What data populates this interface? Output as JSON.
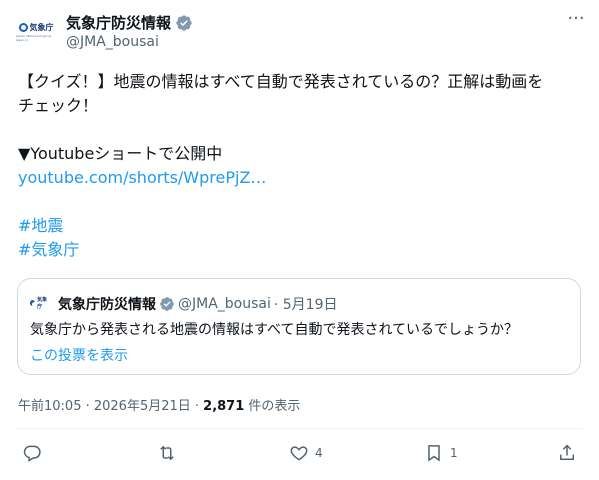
{
  "author": {
    "name": "気象庁防災情報",
    "handle": "@JMA_bousai",
    "logo_text": "気象庁",
    "logo_sub": "Japan Meteorological Agency"
  },
  "post": {
    "lines": [
      "【クイズ！】地震の情報はすべて自動で発表されているの？正解は動画を",
      "チェック！",
      "",
      "▼Youtubeショートで公開中",
      "youtube.com/shorts/WprePjZ…",
      "",
      "#地震",
      "#気象庁"
    ]
  },
  "quote": {
    "name": "気象庁防災情報",
    "handle": "@JMA_bousai",
    "date": "· 5月19日",
    "text": "気象庁から発表される地震の情報はすべて自動で発表されているでしょうか？",
    "show_poll": "この投票を表示"
  },
  "meta": {
    "time": "午前10:05 · 2026年5月21日 · ",
    "views": "2,871",
    "views_label": " 件の表示"
  },
  "actions": {
    "reply_count": "",
    "repost_count": "",
    "like_count": "4",
    "bookmark_count": "1"
  },
  "colors": {
    "accent": "#1d9bf0",
    "verified": "#829aab",
    "muted": "#536471"
  }
}
